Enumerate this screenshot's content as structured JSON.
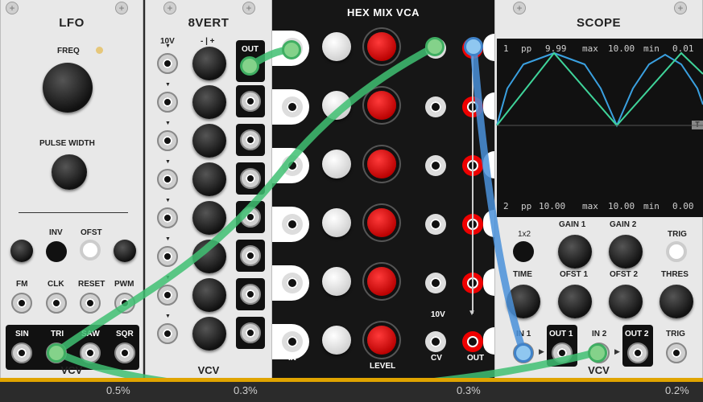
{
  "modules": {
    "lfo": {
      "title": "LFO",
      "freq_label": "FREQ",
      "pulse_width_label": "PULSE WIDTH",
      "inv_label": "INV",
      "ofst_label": "OFST",
      "fm_label": "FM",
      "clk_label": "CLK",
      "reset_label": "RESET",
      "pwm_label": "PWM",
      "sin_label": "SIN",
      "tri_label": "TRI",
      "saw_label": "SAW",
      "sqr_label": "SQR",
      "brand": "VCV",
      "cpu": "0.5%"
    },
    "eightvert": {
      "title": "8VERT",
      "ten_v_label": "10V",
      "sign_label": "- | +",
      "out_label": "OUT",
      "brand": "VCV",
      "cpu": "0.3%"
    },
    "hexmix": {
      "title": "HEX MIX VCA",
      "in_label": "IN",
      "level_label": "LEVEL",
      "ten_v_label": "10V",
      "cv_label": "CV",
      "out_label": "OUT",
      "cpu": "0.3%"
    },
    "scope": {
      "title": "SCOPE",
      "ch1": {
        "index": "1",
        "pp_label": "pp",
        "pp": "9.99",
        "max_label": "max",
        "max": "10.00",
        "min_label": "min",
        "min": "0.01"
      },
      "ch2": {
        "index": "2",
        "pp_label": "pp",
        "pp": "10.00",
        "max_label": "max",
        "max": "10.00",
        "min_label": "min",
        "min": "0.00"
      },
      "trig_marker": "T",
      "x12_label": "1x2",
      "gain1_label": "GAIN 1",
      "gain2_label": "GAIN 2",
      "trig_label": "TRIG",
      "time_label": "TIME",
      "ofst1_label": "OFST 1",
      "ofst2_label": "OFST 2",
      "thres_label": "THRES",
      "in1_label": "IN 1",
      "out1_label": "OUT 1",
      "in2_label": "IN 2",
      "out2_label": "OUT 2",
      "trig_in_label": "TRIG",
      "brand": "VCV",
      "cpu": "0.2%"
    }
  },
  "colors": {
    "cable_green": "#3fbf72",
    "cable_blue": "#4a90d9",
    "trace_ch1": "#3aa0e0",
    "trace_ch2": "#3fd49a",
    "level_knob": "#e01010"
  },
  "icons": [
    "screw-icon",
    "arrow-down-icon",
    "arrow-right-icon"
  ]
}
